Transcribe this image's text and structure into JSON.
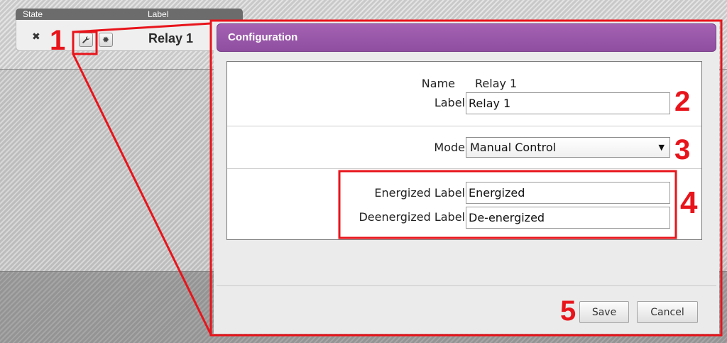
{
  "relay_table": {
    "headers": {
      "state": "State",
      "label": "Label"
    },
    "row": {
      "state_icon": "close-icon",
      "label": "Relay 1"
    },
    "icons": {
      "configure": "wrench-icon",
      "settings": "gear-icon"
    }
  },
  "dialog": {
    "title": "Configuration",
    "name_label": "Name",
    "name_value": "Relay 1",
    "label_label": "Label",
    "label_value": "Relay 1",
    "mode_label": "Mode",
    "mode_value": "Manual Control",
    "energized_label_label": "Energized Label",
    "energized_label_value": "Energized",
    "deenergized_label_label": "Deenergized Label",
    "deenergized_label_value": "De-energized",
    "save_label": "Save",
    "cancel_label": "Cancel"
  },
  "callouts": [
    "1",
    "2",
    "3",
    "4",
    "5"
  ],
  "colors": {
    "dialog_header": "#9b59ae",
    "callout": "#e8141b"
  }
}
